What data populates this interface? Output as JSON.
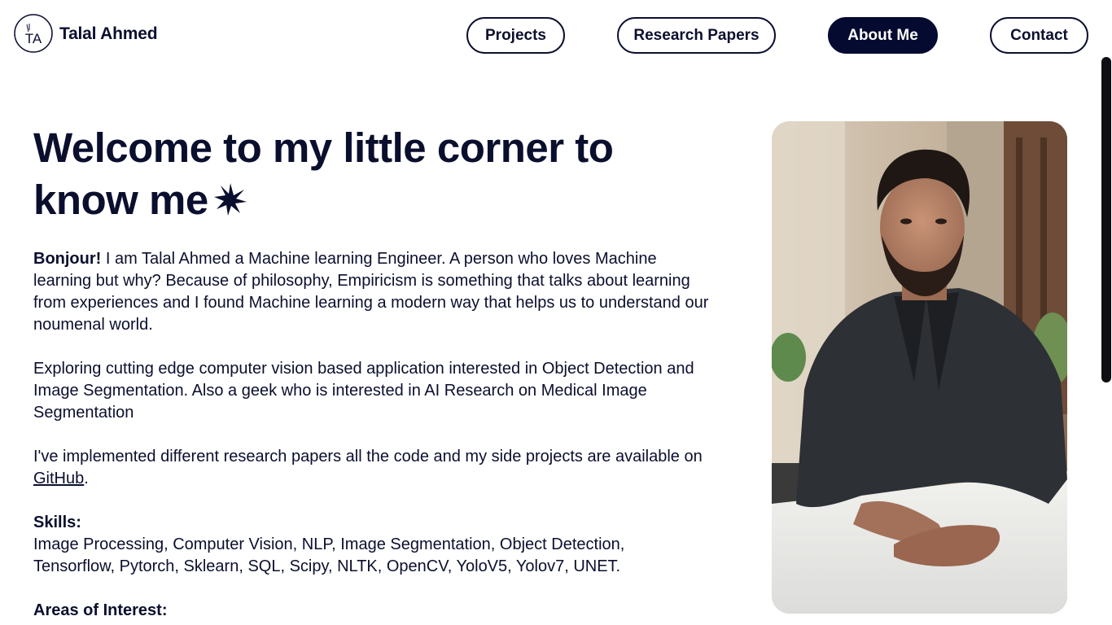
{
  "header": {
    "logo_initials": "TA",
    "brand_name": "Talal Ahmed",
    "nav": {
      "projects": "Projects",
      "research_papers": "Research Papers",
      "about_me": "About Me",
      "contact": "Contact"
    },
    "active_tab": "About Me"
  },
  "main": {
    "title": "Welcome to my little corner to know me",
    "intro": {
      "greeting": "Bonjour!",
      "text": " I am Talal Ahmed a Machine learning Engineer. A person who loves Machine learning but why? Because of philosophy, Empiricism is something that talks about learning from experiences and I found Machine learning a modern way that helps us to understand our noumenal world."
    },
    "paragraph_2": "Exploring cutting edge computer vision based application interested in Object Detection and Image Segmentation. Also a geek who is interested in AI Research on Medical Image Segmentation",
    "paragraph_3": {
      "before_link": "I've implemented different research papers all the code and my side projects are available on ",
      "link_text": "GitHub",
      "after_link": "."
    },
    "skills": {
      "heading": "Skills:",
      "list": "Image Processing, Computer Vision, NLP, Image Segmentation, Object Detection, Tensorflow, Pytorch, Sklearn, SQL, Scipy, NLTK, OpenCV, YoloV5, Yolov7, UNET."
    },
    "areas_of_interest": {
      "heading": "Areas of Interest:"
    }
  },
  "icons": {
    "title_decoration": "asterisk-star-icon",
    "logo": "ta-monogram-logo"
  },
  "colors": {
    "text": "#0b0f2e",
    "active_nav_bg": "#050a30",
    "background": "#ffffff"
  }
}
